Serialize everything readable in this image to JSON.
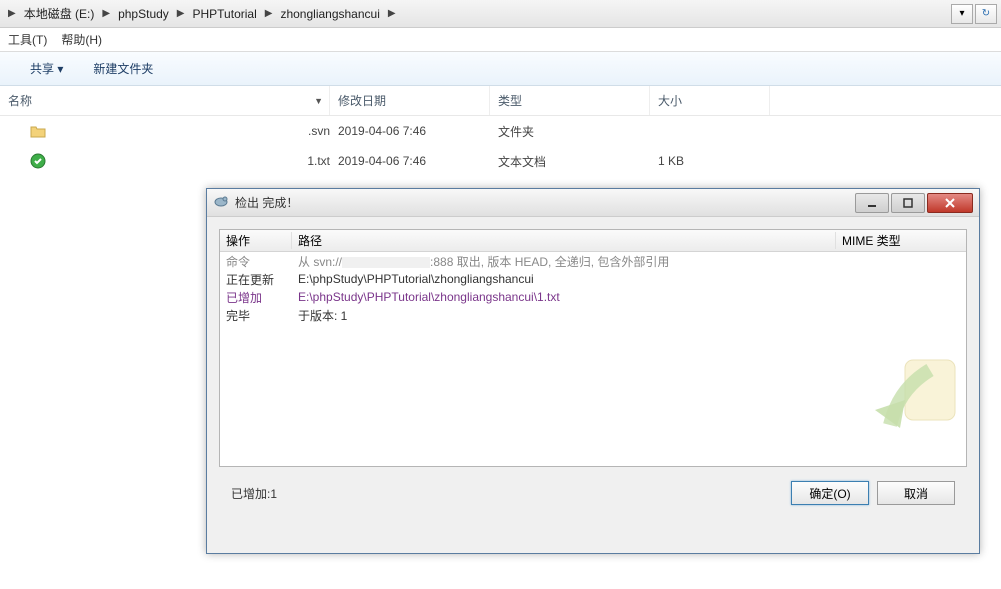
{
  "breadcrumb": {
    "items": [
      "本地磁盘 (E:)",
      "phpStudy",
      "PHPTutorial",
      "zhongliangshancui"
    ]
  },
  "menu": {
    "tools": "工具(T)",
    "help": "帮助(H)"
  },
  "toolbar": {
    "share": "共享 ▾",
    "newfolder": "新建文件夹"
  },
  "columns": {
    "name": "名称",
    "modified": "修改日期",
    "type": "类型",
    "size": "大小"
  },
  "files": [
    {
      "name": ".svn",
      "modified": "2019-04-06 7:46",
      "type": "文件夹",
      "size": ""
    },
    {
      "name": "1.txt",
      "modified": "2019-04-06 7:46",
      "type": "文本文档",
      "size": "1 KB"
    }
  ],
  "dialog": {
    "title": "检出 完成！",
    "headers": {
      "op": "操作",
      "path": "路径",
      "mime": "MIME 类型"
    },
    "rows": [
      {
        "cls": "gray",
        "op": "命令",
        "path_prefix": "从 svn://",
        "path_suffix": ":888 取出, 版本 HEAD, 全递归, 包含外部引用",
        "redacted": true
      },
      {
        "cls": "",
        "op": "正在更新",
        "path": "E:\\phpStudy\\PHPTutorial\\zhongliangshancui"
      },
      {
        "cls": "purple",
        "op": "已增加",
        "path": "E:\\phpStudy\\PHPTutorial\\zhongliangshancui\\1.txt"
      },
      {
        "cls": "",
        "op": "完毕",
        "path": "于版本: 1"
      }
    ],
    "footer_added": "已增加:1",
    "ok": "确定(O)",
    "cancel": "取消"
  }
}
